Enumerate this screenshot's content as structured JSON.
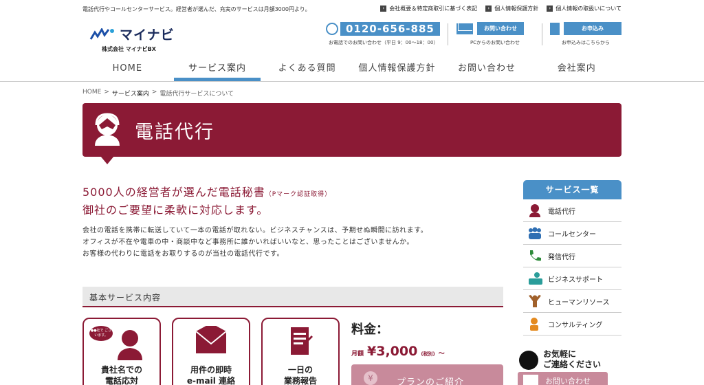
{
  "header": {
    "tagline": "電話代行やコールセンターサービス。経営者が選んだ、充実のサービスは月額3000円より。",
    "toplinks": [
      "会社概要＆特定商取引に基づく表記",
      "個人情報保護方針",
      "個人情報の取扱いについて"
    ],
    "logo_text": "マイナビ",
    "logo_sub": "株式会社 マイナビBX",
    "phone": "0120-656-885",
    "phone_note": "お電話でのお問い合わせ（平日 9：00〜18：00）",
    "contact_button": "お問い合わせ",
    "contact_note": "PCからのお問い合わせ",
    "apply_button": "お申込み",
    "apply_note": "お申込みはこちらから"
  },
  "nav": [
    "HOME",
    "サービス案内",
    "よくある質問",
    "個人情報保護方針",
    "お問い合わせ",
    "会社案内"
  ],
  "breadcrumb": [
    "HOME",
    ">",
    "サービス案内",
    ">",
    "電話代行サービスについて"
  ],
  "hero": {
    "title": "電話代行"
  },
  "lead": {
    "line1": "5000人の経営者が選んだ電話秘書",
    "line1_note": "（Pマーク認証取得）",
    "line2": "御社のご要望に柔軟に対応します。"
  },
  "body": [
    "会社の電話を携帯に転送していて一本の電話が取れない。ビジネスチャンスは、予期せぬ瞬間に訪れます。",
    "オフィスが不在や電車の中・商談中など事務所に誰かいればいいなと、思ったことはございませんか。",
    "お客様の代わりに電話をお取りするのが当社の電話代行です。"
  ],
  "basic_title": "基本サービス内容",
  "cards": [
    {
      "bubble": "●●社で ございます。",
      "title1": "貴社名での",
      "title2": "電話応対"
    },
    {
      "title1": "用件の即時",
      "title2": "e-mail 連絡"
    },
    {
      "title1": "一日の",
      "title2": "業務報告"
    }
  ],
  "price": {
    "label": "料金：",
    "monthly": "月額",
    "amount": "¥3,000",
    "tax": "(税別)",
    "tilde": "〜",
    "plan_icon": "¥",
    "plan_button": "プランのご紹介"
  },
  "sidebar": {
    "title": "サービス一覧",
    "items": [
      "電話代行",
      "コールセンター",
      "発信代行",
      "ビジネスサポート",
      "ヒューマンリソース",
      "コンサルティング"
    ]
  },
  "cta": {
    "line1": "お気軽に",
    "line2": "ご連絡ください",
    "button": "お問い合わせ"
  },
  "colors": {
    "brand": "#8b1a35",
    "accent": "#4a90c7",
    "button_pink": "#c88a9b"
  }
}
